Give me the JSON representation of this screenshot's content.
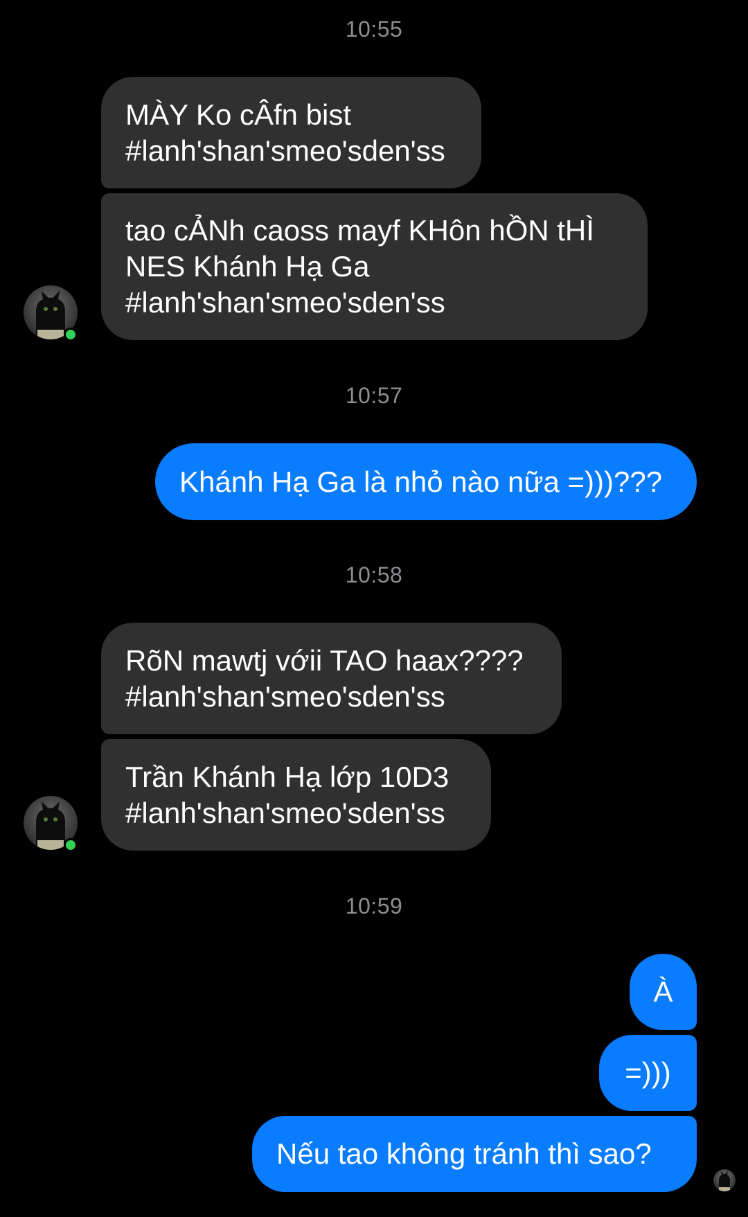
{
  "timestamps": [
    "10:55",
    "10:57",
    "10:58",
    "10:59"
  ],
  "messages": [
    {
      "from": "them",
      "text": "MÀY Ko cÂfn bist\n#lanh'shan'smeo'sden'ss"
    },
    {
      "from": "them",
      "text": "tao cẢNh caoss mayf KHôn hỒN tHÌ\nNES Khánh Hạ Ga\n#lanh'shan'smeo'sden'ss"
    },
    {
      "from": "me",
      "text": "Khánh Hạ Ga là nhỏ nào nữa =)))???"
    },
    {
      "from": "them",
      "text": "RõN mawtj vớii TAO haax????\n#lanh'shan'smeo'sden'ss"
    },
    {
      "from": "them",
      "text": "Trần Khánh Hạ lớp 10D3\n#lanh'shan'smeo'sden'ss"
    },
    {
      "from": "me",
      "text": "À"
    },
    {
      "from": "me",
      "text": "=)))"
    },
    {
      "from": "me",
      "text": "Nếu tao không tránh thì sao?"
    }
  ],
  "colors": {
    "background": "#000000",
    "incoming_bubble": "#303030",
    "outgoing_bubble": "#0a7cff",
    "timestamp": "#8e8e93",
    "online": "#31d158"
  },
  "icons": {
    "contact_avatar": "black-cat-avatar",
    "online_indicator": "online-dot",
    "read_receipt": "read-receipt-avatar"
  }
}
